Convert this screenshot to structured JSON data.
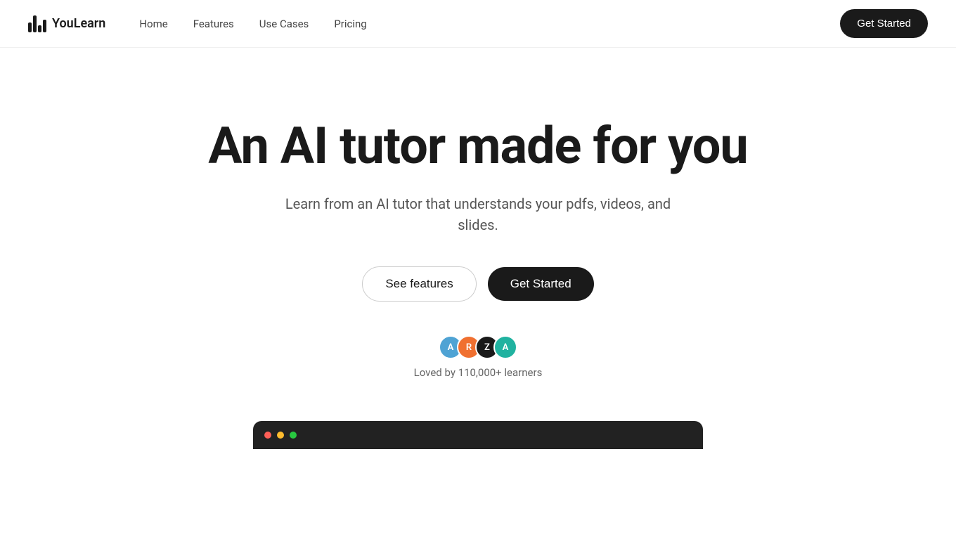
{
  "logo": {
    "name": "YouLearn",
    "text": "YouLearn"
  },
  "nav": {
    "links": [
      {
        "id": "home",
        "label": "Home",
        "href": "#"
      },
      {
        "id": "features",
        "label": "Features",
        "href": "#"
      },
      {
        "id": "use-cases",
        "label": "Use Cases",
        "href": "#"
      },
      {
        "id": "pricing",
        "label": "Pricing",
        "href": "#"
      }
    ],
    "cta": "Get Started"
  },
  "hero": {
    "title": "An AI tutor made for you",
    "subtitle": "Learn from an AI tutor that understands your pdfs, videos, and slides.",
    "btn_see_features": "See features",
    "btn_get_started": "Get Started"
  },
  "social_proof": {
    "loved_text": "Loved by 110,000+ learners",
    "avatars": [
      {
        "id": "a1",
        "initial": "A",
        "color": "#4fa3d4"
      },
      {
        "id": "r",
        "initial": "R",
        "color": "#f07030"
      },
      {
        "id": "z",
        "initial": "Z",
        "color": "#1a1a1a"
      },
      {
        "id": "a2",
        "initial": "A",
        "color": "#20b2a0"
      }
    ]
  }
}
